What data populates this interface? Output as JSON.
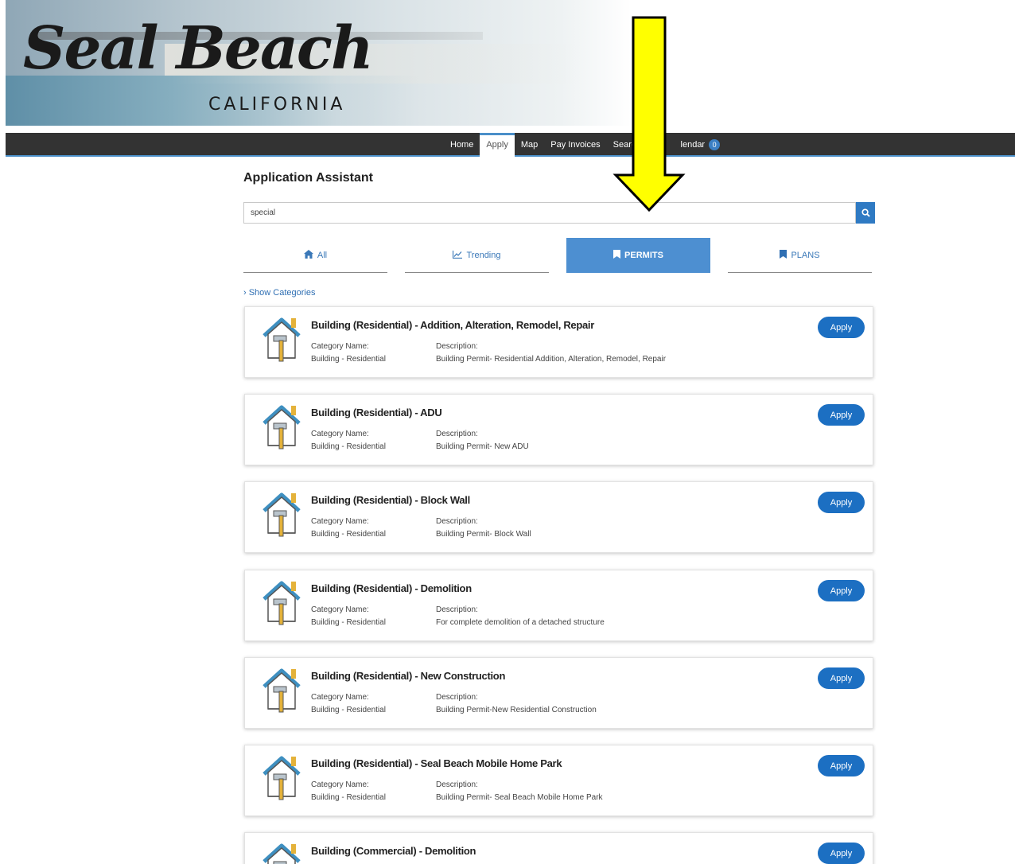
{
  "banner": {
    "logo_script": "Seal Beach",
    "logo_sub": "CALIFORNIA"
  },
  "nav": {
    "items": [
      {
        "label": "Home",
        "active": false
      },
      {
        "label": "Apply",
        "active": true
      },
      {
        "label": "Map",
        "active": false
      },
      {
        "label": "Pay Invoices",
        "active": false
      },
      {
        "label": "Search",
        "active": false
      },
      {
        "label": "lendar",
        "active": false
      }
    ],
    "calendar_count": "0"
  },
  "page": {
    "title": "Application Assistant"
  },
  "search": {
    "value": "special"
  },
  "tabs": [
    {
      "label": "All",
      "icon": "home-icon",
      "active": false
    },
    {
      "label": "Trending",
      "icon": "line-chart-icon",
      "active": false
    },
    {
      "label": "PERMITS",
      "icon": "bookmark-icon",
      "active": true
    },
    {
      "label": "PLANS",
      "icon": "bookmark-icon",
      "active": false
    }
  ],
  "show_categories": "› Show Categories",
  "cards": [
    {
      "title": "Building (Residential) - Addition, Alteration, Remodel, Repair",
      "category_label": "Category Name:",
      "category": "Building - Residential",
      "description_label": "Description:",
      "description": "Building Permit- Residential Addition, Alteration, Remodel, Repair",
      "apply_label": "Apply"
    },
    {
      "title": "Building (Residential) - ADU",
      "category_label": "Category Name:",
      "category": "Building - Residential",
      "description_label": "Description:",
      "description": "Building Permit- New ADU",
      "apply_label": "Apply"
    },
    {
      "title": "Building (Residential) - Block Wall",
      "category_label": "Category Name:",
      "category": "Building - Residential",
      "description_label": "Description:",
      "description": "Building Permit- Block Wall",
      "apply_label": "Apply"
    },
    {
      "title": "Building (Residential) - Demolition",
      "category_label": "Category Name:",
      "category": "Building - Residential",
      "description_label": "Description:",
      "description": "For complete demolition of a detached structure",
      "apply_label": "Apply"
    },
    {
      "title": "Building (Residential) - New Construction",
      "category_label": "Category Name:",
      "category": "Building - Residential",
      "description_label": "Description:",
      "description": "Building Permit-New Residential Construction",
      "apply_label": "Apply"
    },
    {
      "title": "Building (Residential) - Seal Beach Mobile Home Park",
      "category_label": "Category Name:",
      "category": "Building - Residential",
      "description_label": "Description:",
      "description": "Building Permit- Seal Beach Mobile Home Park",
      "apply_label": "Apply"
    },
    {
      "title": "Building (Commercial) - Demolition",
      "category_label": "",
      "category": "",
      "description_label": "",
      "description": "",
      "apply_label": "Apply"
    }
  ],
  "colors": {
    "nav_bg": "#333333",
    "accent": "#4d8fd1",
    "apply_button": "#1c6fc2",
    "arrow_fill": "#ffff00"
  }
}
